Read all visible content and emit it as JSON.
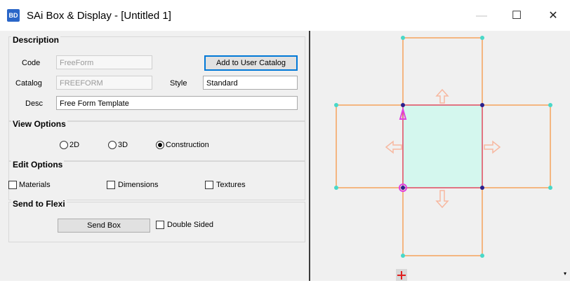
{
  "window": {
    "app_icon_text": "BD",
    "title": "SAi Box & Display - [Untitled 1]",
    "minimize_glyph": "—",
    "maximize_glyph": "☐",
    "close_glyph": "✕"
  },
  "description": {
    "title": "Description",
    "code_label": "Code",
    "code_value": "FreeForm",
    "catalog_label": "Catalog",
    "catalog_value": "FREEFORM",
    "style_label": "Style",
    "style_value": "Standard",
    "desc_label": "Desc",
    "desc_value": "Free Form Template",
    "add_button": "Add to User Catalog"
  },
  "view_options": {
    "title": "View Options",
    "options": [
      {
        "label": "2D",
        "checked": false
      },
      {
        "label": "3D",
        "checked": false
      },
      {
        "label": "Construction",
        "checked": true
      }
    ]
  },
  "edit_options": {
    "title": "Edit Options",
    "options": [
      {
        "label": "Materials",
        "checked": false
      },
      {
        "label": "Dimensions",
        "checked": false
      },
      {
        "label": "Textures",
        "checked": false
      }
    ]
  },
  "send_to_flexi": {
    "title": "Send to Flexi",
    "send_button": "Send Box",
    "double_sided_label": "Double Sided",
    "double_sided_checked": false
  },
  "canvas": {
    "background": "#f0f0f0",
    "panel_color": "#f5a35c",
    "base_fill": "#d4f7ee",
    "base_border": "#e0506a",
    "arrow_color": "#f7b8a0",
    "corner_node_color": "#48d8c8",
    "inner_node_color": "#2a1f8c",
    "selected_color": "#e040e0",
    "scroll_down_glyph": "▾"
  }
}
